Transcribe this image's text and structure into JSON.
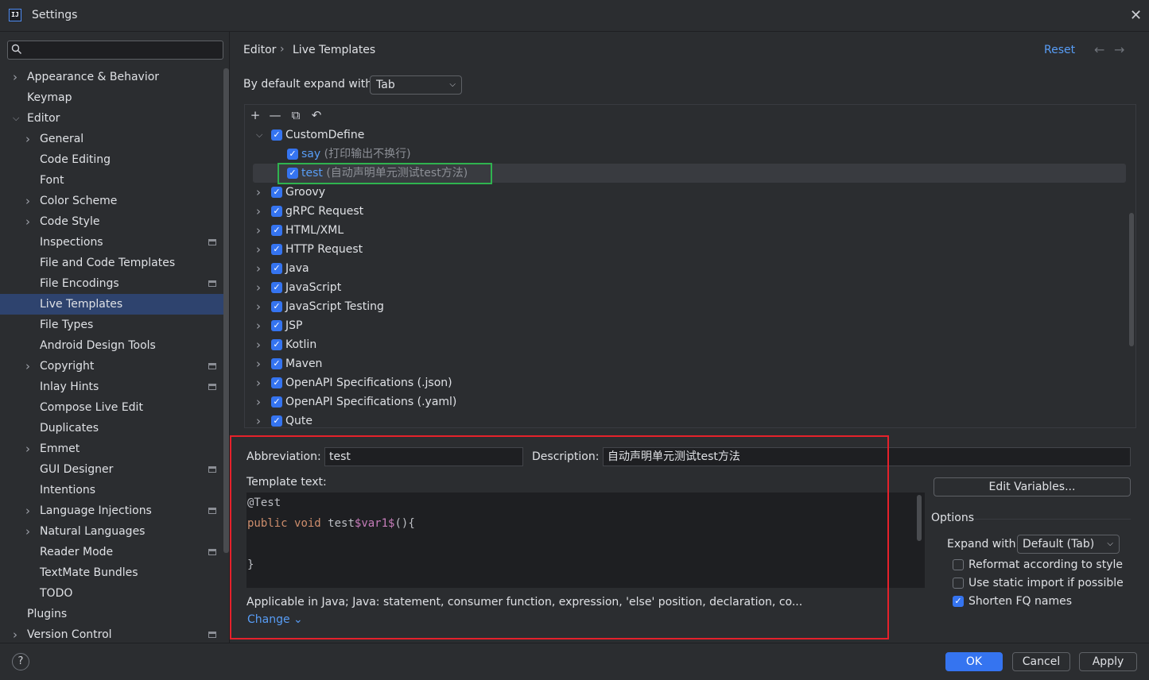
{
  "window": {
    "title": "Settings",
    "icon_text": "IJ"
  },
  "search": {
    "placeholder": ""
  },
  "sidebar": {
    "items": [
      {
        "label": "Appearance & Behavior",
        "level": 0,
        "chevron": "right",
        "bold": true
      },
      {
        "label": "Keymap",
        "level": 0,
        "chevron": "",
        "bold": true
      },
      {
        "label": "Editor",
        "level": 0,
        "chevron": "down",
        "bold": true
      },
      {
        "label": "General",
        "level": 1,
        "chevron": "right"
      },
      {
        "label": "Code Editing",
        "level": 1,
        "chevron": ""
      },
      {
        "label": "Font",
        "level": 1,
        "chevron": ""
      },
      {
        "label": "Color Scheme",
        "level": 1,
        "chevron": "right"
      },
      {
        "label": "Code Style",
        "level": 1,
        "chevron": "right"
      },
      {
        "label": "Inspections",
        "level": 1,
        "chevron": "",
        "project_icon": true
      },
      {
        "label": "File and Code Templates",
        "level": 1,
        "chevron": ""
      },
      {
        "label": "File Encodings",
        "level": 1,
        "chevron": "",
        "project_icon": true
      },
      {
        "label": "Live Templates",
        "level": 1,
        "chevron": "",
        "selected": true
      },
      {
        "label": "File Types",
        "level": 1,
        "chevron": ""
      },
      {
        "label": "Android Design Tools",
        "level": 1,
        "chevron": ""
      },
      {
        "label": "Copyright",
        "level": 1,
        "chevron": "right",
        "project_icon": true
      },
      {
        "label": "Inlay Hints",
        "level": 1,
        "chevron": "",
        "project_icon": true
      },
      {
        "label": "Compose Live Edit",
        "level": 1,
        "chevron": ""
      },
      {
        "label": "Duplicates",
        "level": 1,
        "chevron": ""
      },
      {
        "label": "Emmet",
        "level": 1,
        "chevron": "right"
      },
      {
        "label": "GUI Designer",
        "level": 1,
        "chevron": "",
        "project_icon": true
      },
      {
        "label": "Intentions",
        "level": 1,
        "chevron": ""
      },
      {
        "label": "Language Injections",
        "level": 1,
        "chevron": "right",
        "project_icon": true
      },
      {
        "label": "Natural Languages",
        "level": 1,
        "chevron": "right"
      },
      {
        "label": "Reader Mode",
        "level": 1,
        "chevron": "",
        "project_icon": true
      },
      {
        "label": "TextMate Bundles",
        "level": 1,
        "chevron": ""
      },
      {
        "label": "TODO",
        "level": 1,
        "chevron": ""
      },
      {
        "label": "Plugins",
        "level": 0,
        "chevron": "",
        "bold": true
      },
      {
        "label": "Version Control",
        "level": 0,
        "chevron": "right",
        "bold": true,
        "project_icon": true
      }
    ]
  },
  "breadcrumb": {
    "parent": "Editor",
    "separator": "›",
    "current": "Live Templates"
  },
  "header": {
    "reset": "Reset",
    "back": "←",
    "forward": "→"
  },
  "expand_default": {
    "label": "By default expand with",
    "value": "Tab"
  },
  "toolbar": {
    "add": "+",
    "remove": "—",
    "copy": "⧉",
    "restore": "↶"
  },
  "templates": [
    {
      "name": "CustomDefine",
      "expanded": true,
      "checked": true
    },
    {
      "name": "say",
      "desc": "(打印输出不换行)",
      "child": true,
      "checked": true
    },
    {
      "name": "test",
      "desc": "(自动声明单元测试test方法)",
      "child": true,
      "checked": true,
      "selected": true
    },
    {
      "name": "Groovy",
      "checked": true
    },
    {
      "name": "gRPC Request",
      "checked": true
    },
    {
      "name": "HTML/XML",
      "checked": true
    },
    {
      "name": "HTTP Request",
      "checked": true
    },
    {
      "name": "Java",
      "checked": true
    },
    {
      "name": "JavaScript",
      "checked": true
    },
    {
      "name": "JavaScript Testing",
      "checked": true
    },
    {
      "name": "JSP",
      "checked": true
    },
    {
      "name": "Kotlin",
      "checked": true
    },
    {
      "name": "Maven",
      "checked": true
    },
    {
      "name": "OpenAPI Specifications (.json)",
      "checked": true
    },
    {
      "name": "OpenAPI Specifications (.yaml)",
      "checked": true
    },
    {
      "name": "Qute",
      "checked": true
    }
  ],
  "detail": {
    "abbr_label": "Abbreviation:",
    "abbr_value": "test",
    "desc_label": "Description:",
    "desc_value": "自动声明单元测试test方法",
    "template_label": "Template text:",
    "code": {
      "line1": "@Test",
      "line2_kw1": "public",
      "line2_kw2": "void",
      "line2_name": "test",
      "line2_var": "$var1$",
      "line2_tail": "(){",
      "line4": "}"
    },
    "applicable": "Applicable in Java; Java: statement, consumer function, expression, 'else' position, declaration, co...",
    "change": "Change ⌄"
  },
  "options": {
    "edit_variables": "Edit Variables...",
    "title": "Options",
    "expand_with_label": "Expand with",
    "expand_with_value": "Default (Tab)",
    "checkboxes": [
      {
        "label": "Reformat according to style",
        "checked": false
      },
      {
        "label": "Use static import if possible",
        "checked": false
      },
      {
        "label": "Shorten FQ names",
        "checked": true
      }
    ]
  },
  "footer": {
    "help": "?",
    "ok": "OK",
    "cancel": "Cancel",
    "apply": "Apply"
  },
  "colors": {
    "accent": "#3574f0",
    "link": "#589df6",
    "highlight_green": "#2fb34f",
    "highlight_red": "#e5212b",
    "selection": "#2e436e"
  }
}
